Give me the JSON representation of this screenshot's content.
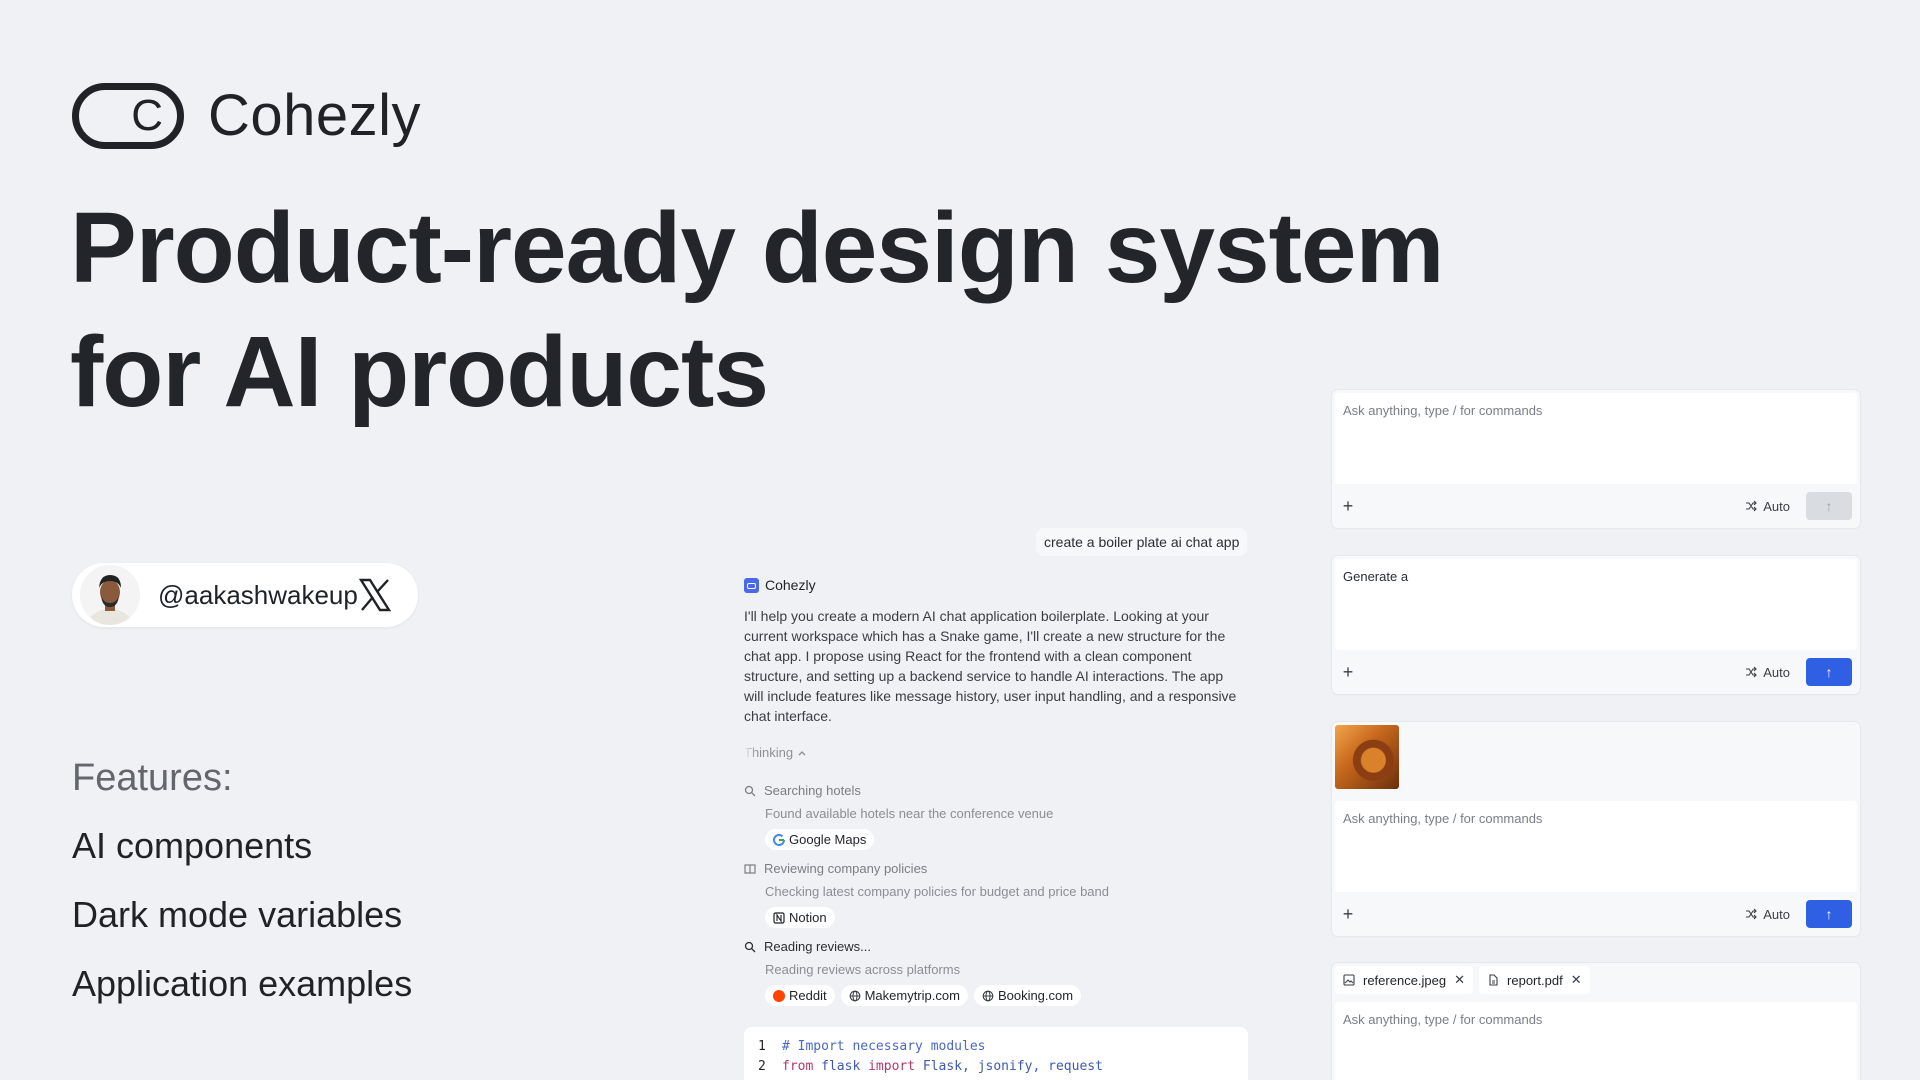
{
  "brand": {
    "name": "Cohezly",
    "logo_letter": "C"
  },
  "headline": {
    "line1": "Product-ready design system",
    "line2": "for AI products"
  },
  "author": {
    "handle": "@aakashwakeup",
    "social_icon": "x-logo-icon"
  },
  "features": {
    "title": "Features:",
    "items": [
      "AI components",
      "Dark mode variables",
      "Application examples"
    ]
  },
  "chat": {
    "user_message": "create a boiler plate ai chat app",
    "assistant_name": "Cohezly",
    "assistant_text": "I'll help you create a modern AI chat application boilerplate. Looking at your current workspace which has a Snake game, I'll create a new structure for the chat app. I propose using React for the frontend with a clean component structure, and setting up a backend service to handle AI interactions. The app will include features like message history, user input handling, and a responsive chat interface.",
    "thinking_label": "Thinking",
    "steps": [
      {
        "title": "Searching hotels",
        "desc": "Found available hotels near the conference venue",
        "chips": [
          "Google Maps"
        ]
      },
      {
        "title": "Reviewing company policies",
        "desc": "Checking latest company policies for budget and price band",
        "chips": [
          "Notion"
        ]
      },
      {
        "title": "Reading reviews...",
        "desc": "Reading reviews across platforms",
        "chips": [
          "Reddit",
          "Makemytrip.com",
          "Booking.com"
        ]
      }
    ],
    "code": {
      "line1_no": "1",
      "line1": "# Import necessary modules",
      "line2_no": "2",
      "line2_kw1": "from",
      "line2_mod": "flask",
      "line2_kw2": "import",
      "line2_names": "Flask, jsonify, request"
    }
  },
  "inputs": {
    "placeholder": "Ask anything, type / for commands",
    "card2_value": "Generate a",
    "mode_label": "Auto",
    "attachments": [
      "reference.jpeg",
      "report.pdf"
    ],
    "send_active_color": "#2f5fe3"
  }
}
